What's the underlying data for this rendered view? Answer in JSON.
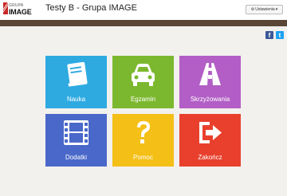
{
  "header": {
    "logo_line1": "GRUPA",
    "logo_line2": "IMAGE",
    "title": "Testy B - Grupa IMAGE",
    "settings_label": "Ustawienia",
    "brand_color": "#c62828"
  },
  "social": {
    "facebook": "f",
    "twitter": "t"
  },
  "tiles": [
    {
      "label": "Nauka",
      "icon": "book-icon",
      "color": "#2eaae1"
    },
    {
      "label": "Egzamin",
      "icon": "car-icon",
      "color": "#7cb82f"
    },
    {
      "label": "Skrzyżowania",
      "icon": "road-icon",
      "color": "#b25ec6"
    },
    {
      "label": "Dodatki",
      "icon": "film-icon",
      "color": "#4a68c9"
    },
    {
      "label": "Pomoc",
      "icon": "question-icon",
      "color": "#f4bf16"
    },
    {
      "label": "Zakończ",
      "icon": "exit-icon",
      "color": "#e8402d"
    }
  ]
}
